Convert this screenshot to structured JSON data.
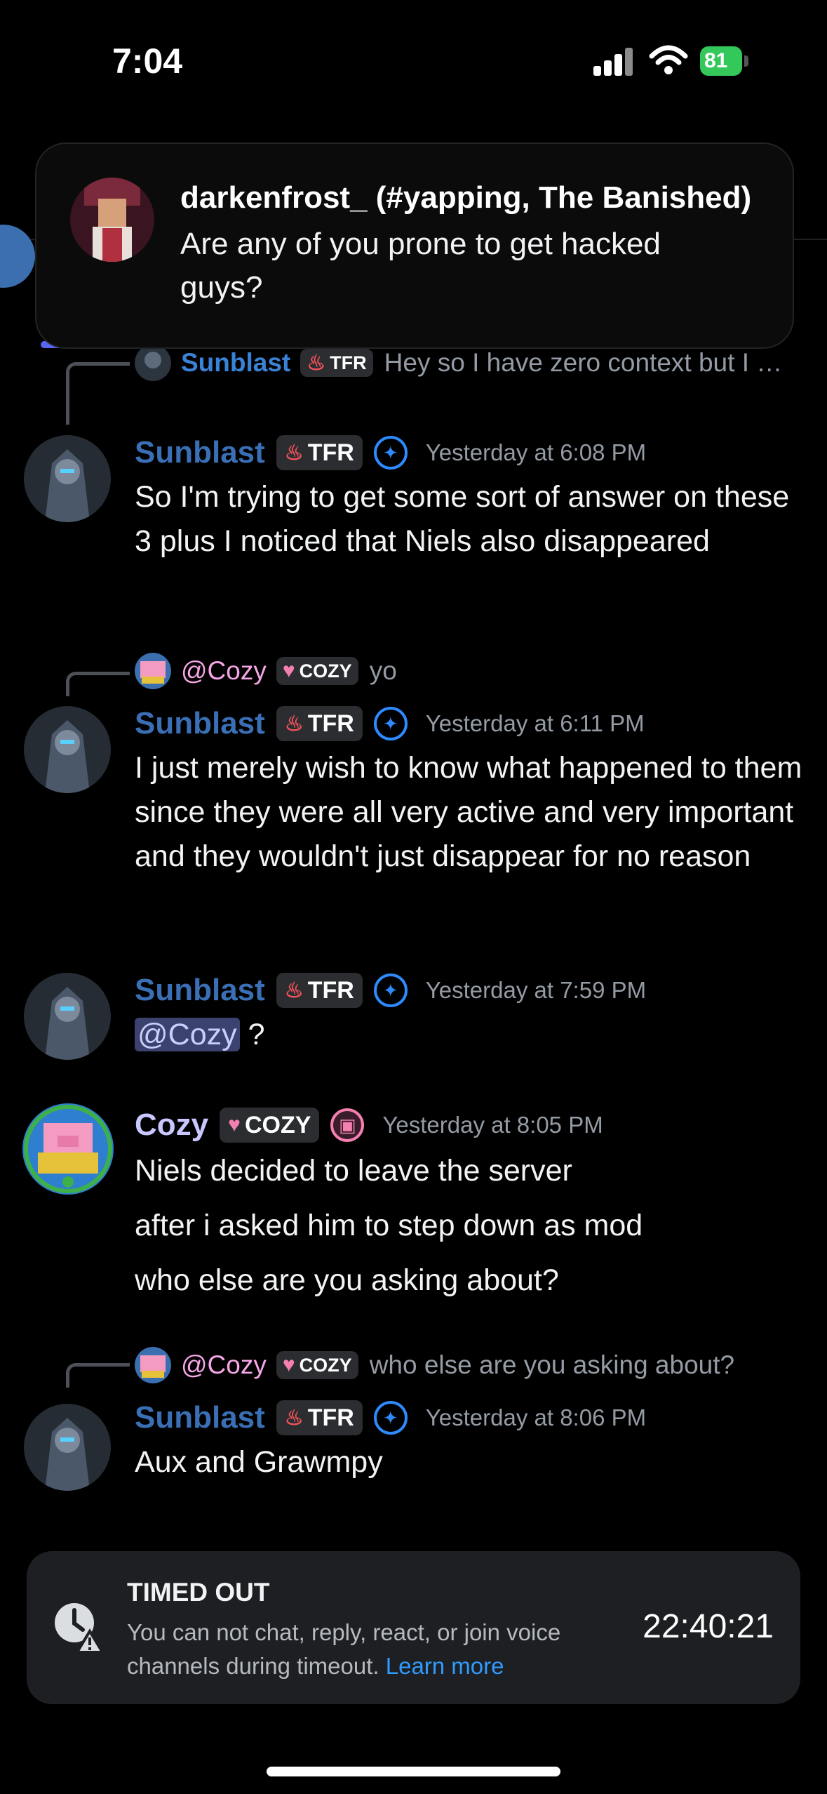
{
  "status_bar": {
    "time": "7:04",
    "battery": "81"
  },
  "notification": {
    "title": "darkenfrost_ (#yapping, The Banished)",
    "body": "Are any of you prone to get hacked guys?"
  },
  "messages": [
    {
      "reply": {
        "name": "Sunblast",
        "tag": "TFR",
        "text": "Hey so I have zero context but I wanted to see where everyone’s been going since I …"
      },
      "author": "Sunblast",
      "tag": "TFR",
      "timestamp": "Yesterday at 6:08 PM",
      "body": "So I'm trying to get some sort of answer on these 3 plus I noticed that Niels also disappeared"
    },
    {
      "reply": {
        "name": "@Cozy",
        "tag": "COZY",
        "text": "yo"
      },
      "author": "Sunblast",
      "tag": "TFR",
      "timestamp": "Yesterday at 6:11 PM",
      "body": "I just merely wish to know what happened to them since they were all very active and very important and they wouldn't just disappear for no reason"
    },
    {
      "author": "Sunblast",
      "tag": "TFR",
      "timestamp": "Yesterday at 7:59 PM",
      "mention": "@Cozy",
      "body_suffix": " ?"
    },
    {
      "author": "Cozy",
      "tag": "COZY",
      "timestamp": "Yesterday at 8:05 PM",
      "lines": [
        "Niels decided to leave the server",
        "after i asked him to step down as mod",
        "who else are you asking about?"
      ]
    },
    {
      "reply": {
        "name": "@Cozy",
        "tag": "COZY",
        "text": "who else are you asking about?"
      },
      "author": "Sunblast",
      "tag": "TFR",
      "timestamp": "Yesterday at 8:06 PM",
      "body": "Aux and Grawmpy"
    }
  ],
  "timeout": {
    "title": "TIMED OUT",
    "description": "You can not chat, reply, react, or join voice channels during timeout.",
    "link": "Learn more",
    "timer": "22:40:21"
  },
  "colors": {
    "username_blue": "#3a6fb5",
    "cozy_name": "#c9c7ff",
    "link": "#2f9bff",
    "accent": "#5865f2"
  }
}
